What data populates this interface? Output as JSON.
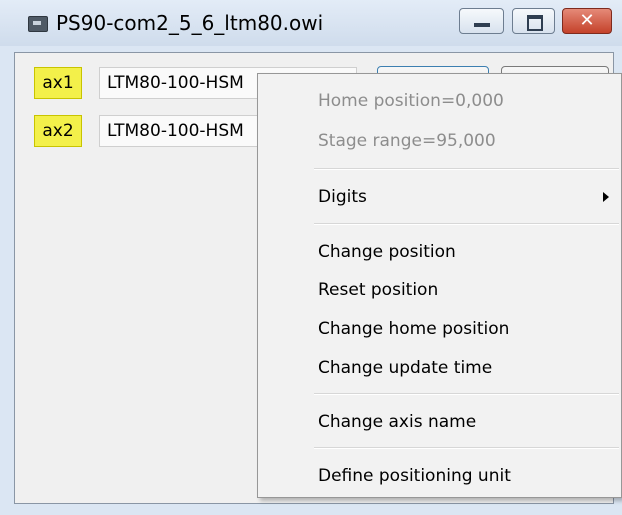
{
  "window": {
    "title": "PS90-com2_5_6_ltm80.owi",
    "close_glyph": "✕",
    "icons": [
      "app-icon",
      "minimize-icon",
      "maximize-icon",
      "close-icon"
    ]
  },
  "axes": [
    {
      "tag": "ax1",
      "stage": "LTM80-100-HSM"
    },
    {
      "tag": "ax2",
      "stage": "LTM80-100-HSM"
    }
  ],
  "context_menu": {
    "items": [
      {
        "label": "Home position=0,000",
        "disabled": true
      },
      {
        "label": "Stage range=95,000",
        "disabled": true
      },
      {
        "label": "Digits",
        "submenu": true
      },
      {
        "label": "Change position"
      },
      {
        "label": "Reset position"
      },
      {
        "label": "Change home position"
      },
      {
        "label": "Change update time"
      },
      {
        "label": "Change axis name"
      },
      {
        "label": "Define positioning unit"
      }
    ]
  },
  "colors": {
    "axis_tag": "#f3f04a",
    "title_bar": "#cfdcec",
    "close_button": "#c4412a",
    "menu_background": "#f2f2f2"
  }
}
